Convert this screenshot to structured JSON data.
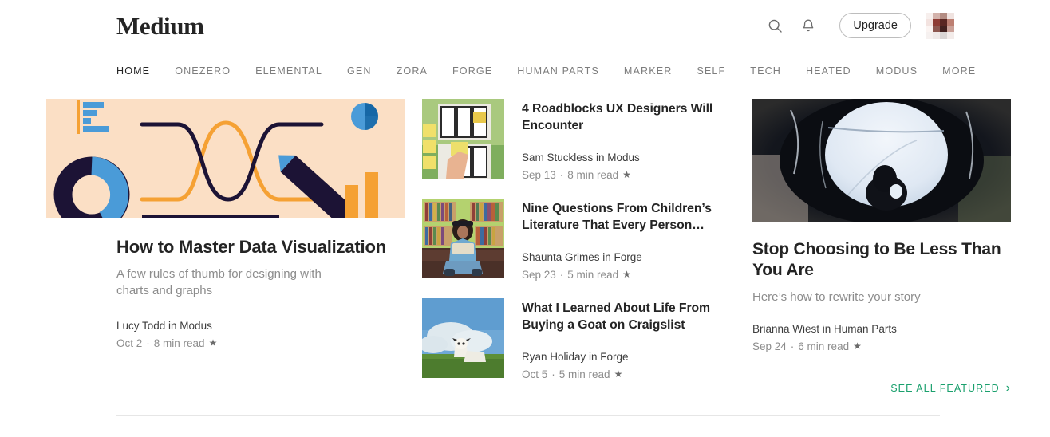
{
  "header": {
    "brand": "Medium",
    "search_icon": "search-icon",
    "bell_icon": "notification-bell-icon",
    "upgrade_label": "Upgrade",
    "avatar_label": "user-avatar"
  },
  "nav": {
    "items": [
      {
        "label": "HOME",
        "active": true
      },
      {
        "label": "ONEZERO",
        "active": false
      },
      {
        "label": "ELEMENTAL",
        "active": false
      },
      {
        "label": "GEN",
        "active": false
      },
      {
        "label": "ZORA",
        "active": false
      },
      {
        "label": "FORGE",
        "active": false
      },
      {
        "label": "HUMAN PARTS",
        "active": false
      },
      {
        "label": "MARKER",
        "active": false
      },
      {
        "label": "SELF",
        "active": false
      },
      {
        "label": "TECH",
        "active": false
      },
      {
        "label": "HEATED",
        "active": false
      },
      {
        "label": "MODUS",
        "active": false
      },
      {
        "label": "MORE",
        "active": false
      }
    ]
  },
  "feature": {
    "image_alt": "data-visualization-illustration",
    "title": "How to Master Data Visualization",
    "subtitle": "A few rules of thumb for designing with charts and graphs",
    "author": "Lucy Todd in Modus",
    "date": "Oct 2",
    "separator": "·",
    "read_time": "8 min read",
    "member_star": "★"
  },
  "middle_list": [
    {
      "image_alt": "hand-placing-sticky-notes-on-wireframes",
      "title": "4 Roadblocks UX Designers Will Encounter",
      "author": "Sam Stuckless in Modus",
      "date": "Sep 13",
      "separator": "·",
      "read_time": "8 min read",
      "member_star": "★"
    },
    {
      "image_alt": "woman-reading-book-in-front-of-bookshelves",
      "title": "Nine Questions From Children’s Literature That Every Person…",
      "author": "Shaunta Grimes in Forge",
      "date": "Sep 23",
      "separator": "·",
      "read_time": "5 min read",
      "member_star": "★"
    },
    {
      "image_alt": "goat-standing-on-grassy-hill",
      "title": "What I Learned About Life From Buying a Goat on Craigslist",
      "author": "Ryan Holiday in Forge",
      "date": "Oct 5",
      "separator": "·",
      "read_time": "5 min read",
      "member_star": "★"
    }
  ],
  "right_feature": {
    "image_alt": "silhouette-seen-through-dark-tunnel",
    "title": "Stop Choosing to Be Less Than You Are",
    "subtitle": "Here’s how to rewrite your story",
    "author": "Brianna Wiest in Human Parts",
    "date": "Sep 24",
    "separator": "·",
    "read_time": "6 min read",
    "member_star": "★"
  },
  "see_all": {
    "label": "SEE ALL FEATURED",
    "chevron": "›"
  },
  "colors": {
    "accent_green": "#1aa06d",
    "text_primary": "#242424",
    "text_secondary": "#8c8c8c",
    "hero_background": "#fbdfc5",
    "hero_navy": "#1c1335",
    "hero_orange": "#f5a134",
    "hero_blue": "#4a9bd8",
    "hero_blue_dark": "#1667a6",
    "border": "#e6e6e6"
  }
}
